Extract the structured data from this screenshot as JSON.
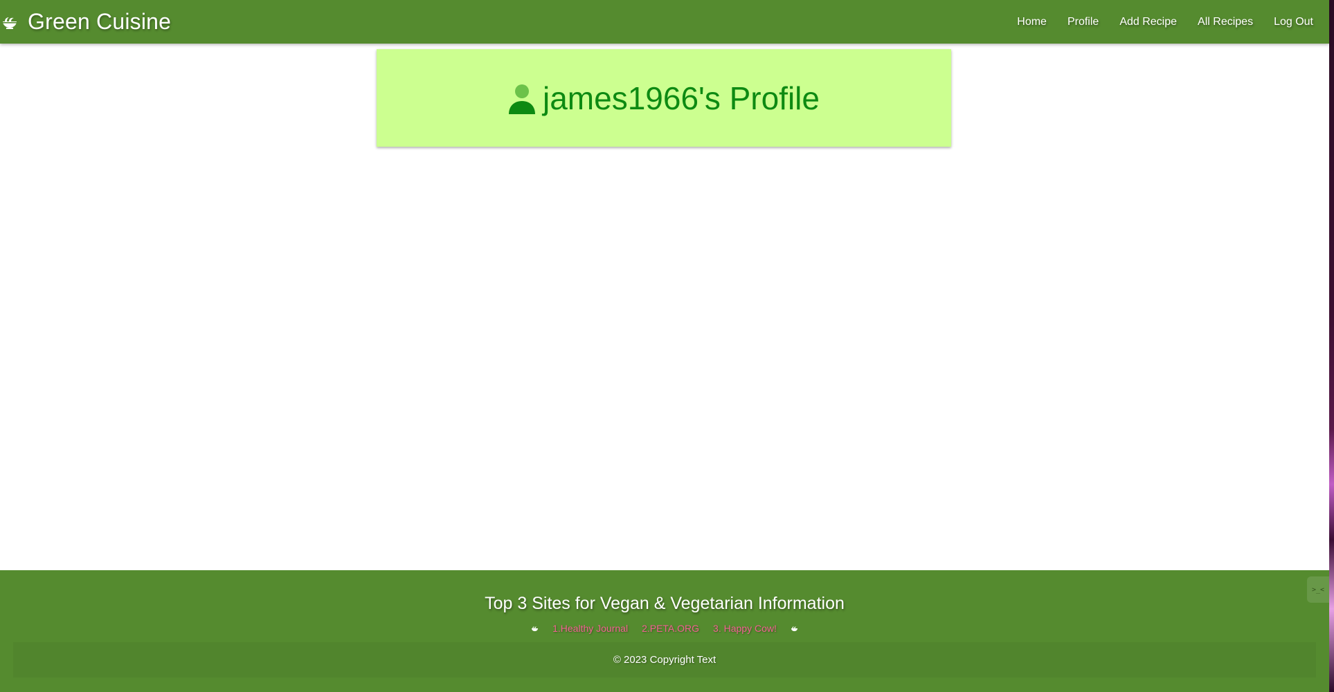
{
  "navbar": {
    "brand": "Green Cuisine",
    "brand_icon": "salad-bowl-icon",
    "links": [
      {
        "label": "Home"
      },
      {
        "label": "Profile"
      },
      {
        "label": "Add Recipe"
      },
      {
        "label": "All Recipes"
      },
      {
        "label": "Log Out"
      }
    ]
  },
  "profile": {
    "heading": "james1966's Profile",
    "icon": "person-icon"
  },
  "footer": {
    "title": "Top 3 Sites for Vegan & Vegetarian Information",
    "links": [
      {
        "label": "1.Healthy Journal"
      },
      {
        "label": "2.PETA.ORG"
      },
      {
        "label": "3. Happy Cow!"
      }
    ],
    "copyright": "© 2023 Copyright Text",
    "console_tab": ">_<"
  },
  "colors": {
    "navbar_bg": "#558b2f",
    "card_bg": "#ccff90",
    "heading": "#0d8a12",
    "footer_link": "#f06292"
  }
}
